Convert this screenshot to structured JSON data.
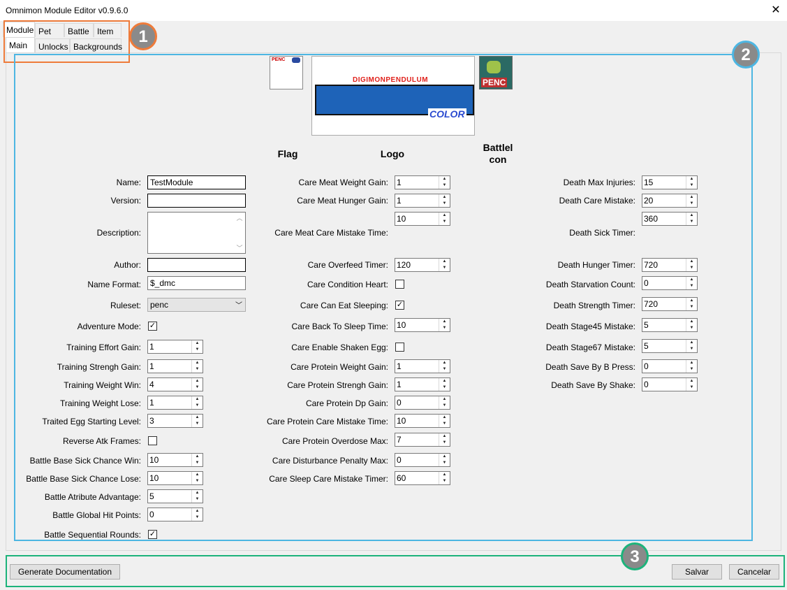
{
  "window": {
    "title": "Omnimon Module Editor v0.9.6.0",
    "close_glyph": "✕"
  },
  "tabs_top": [
    "Module",
    "Pet",
    "Battle",
    "Item"
  ],
  "tabs_sub": [
    "Main",
    "Unlocks",
    "Backgrounds"
  ],
  "images": {
    "flag_label": "Flag",
    "logo_label": "Logo",
    "battleicon_label_1": "Battlel",
    "battleicon_label_2": "con",
    "flag_text": "PENC",
    "logo_line1": "DIGIMONPENDULUM",
    "logo_line2": "COLOR",
    "battleicon_text": "PENC"
  },
  "col1": {
    "name_label": "Name:",
    "name_value": "TestModule",
    "version_label": "Version:",
    "version_value": "",
    "description_label": "Description:",
    "description_value": "",
    "author_label": "Author:",
    "author_value": "",
    "name_format_label": "Name Format:",
    "name_format_value": "$_dmc",
    "ruleset_label": "Ruleset:",
    "ruleset_value": "penc",
    "adventure_mode_label": "Adventure Mode:",
    "adventure_mode_checked": true,
    "training_effort_gain_label": "Training Effort Gain:",
    "training_effort_gain": "1",
    "training_strengh_gain_label": "Training Strengh Gain:",
    "training_strengh_gain": "1",
    "training_weight_win_label": "Training Weight Win:",
    "training_weight_win": "4",
    "training_weight_lose_label": "Training Weight Lose:",
    "training_weight_lose": "1",
    "traited_egg_label": "Traited Egg Starting Level:",
    "traited_egg": "3",
    "reverse_atk_label": "Reverse Atk Frames:",
    "reverse_atk_checked": false,
    "sick_win_label": "Battle Base Sick Chance Win:",
    "sick_win": "10",
    "sick_lose_label": "Battle Base Sick Chance Lose:",
    "sick_lose": "10",
    "atribute_adv_label": "Battle Atribute Advantage:",
    "atribute_adv": "5",
    "global_hp_label": "Battle Global Hit Points:",
    "global_hp": "0",
    "sequential_label": "Battle Sequential Rounds:",
    "sequential_checked": true
  },
  "col2": {
    "meat_weight_label": "Care Meat Weight Gain:",
    "meat_weight": "1",
    "meat_hunger_label": "Care Meat Hunger Gain:",
    "meat_hunger": "1",
    "meat_mistake_label": "Care Meat Care Mistake Time:",
    "meat_mistake": "10",
    "overfeed_label": "Care Overfeed Timer:",
    "overfeed": "120",
    "condition_heart_label": "Care Condition Heart:",
    "condition_heart_checked": false,
    "eat_sleeping_label": "Care Can Eat Sleeping:",
    "eat_sleeping_checked": true,
    "back_to_sleep_label": "Care Back To Sleep Time:",
    "back_to_sleep": "10",
    "shaken_egg_label": "Care Enable Shaken Egg:",
    "shaken_egg_checked": false,
    "protein_weight_label": "Care Protein Weight Gain:",
    "protein_weight": "1",
    "protein_strengh_label": "Care Protein Strengh Gain:",
    "protein_strengh": "1",
    "protein_dp_label": "Care Protein Dp Gain:",
    "protein_dp": "0",
    "protein_mistake_label": "Care Protein Care Mistake Time:",
    "protein_mistake": "10",
    "protein_overdose_label": "Care Protein Overdose Max:",
    "protein_overdose": "7",
    "disturbance_label": "Care Disturbance Penalty Max:",
    "disturbance": "0",
    "sleep_mistake_label": "Care Sleep Care Mistake Timer:",
    "sleep_mistake": "60"
  },
  "col3": {
    "max_injuries_label": "Death Max Injuries:",
    "max_injuries": "15",
    "care_mistake_label": "Death Care Mistake:",
    "care_mistake": "20",
    "sick_timer_label": "Death Sick Timer:",
    "sick_timer": "360",
    "hunger_timer_label": "Death Hunger Timer:",
    "hunger_timer": "720",
    "starvation_label": "Death Starvation Count:",
    "starvation": "0",
    "strength_timer_label": "Death Strength Timer:",
    "strength_timer": "720",
    "stage45_label": "Death Stage45 Mistake:",
    "stage45": "5",
    "stage67_label": "Death Stage67 Mistake:",
    "stage67": "5",
    "save_b_label": "Death Save By B Press:",
    "save_b": "0",
    "save_shake_label": "Death Save By Shake:",
    "save_shake": "0"
  },
  "footer": {
    "generate_doc": "Generate Documentation",
    "save": "Salvar",
    "cancel": "Cancelar"
  },
  "callouts": [
    "1",
    "2",
    "3"
  ],
  "colors": {
    "callout1": "#ee7b3a",
    "callout2": "#4db6e2",
    "callout3": "#1db37b",
    "callout_fill": "#8a8a8a"
  }
}
